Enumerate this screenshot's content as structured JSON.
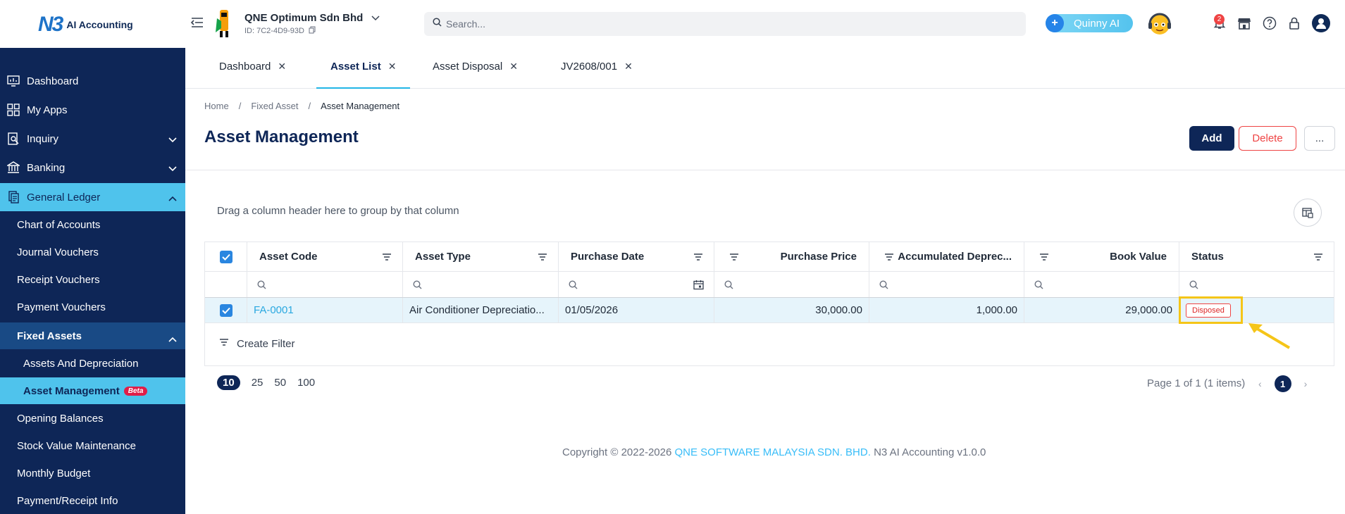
{
  "topbar": {
    "logo_mark": "N3",
    "logo_text": "AI Accounting",
    "company_name": "QNE Optimum Sdn Bhd",
    "company_id": "ID: 7C2-4D9-93D",
    "search_placeholder": "Search...",
    "assistant_label": "Quinny AI",
    "notification_count": "2"
  },
  "sidebar": {
    "items": [
      {
        "label": "Dashboard",
        "icon": "dashboard-icon"
      },
      {
        "label": "My Apps",
        "icon": "apps-icon"
      },
      {
        "label": "Inquiry",
        "icon": "inquiry-icon"
      },
      {
        "label": "Banking",
        "icon": "bank-icon"
      },
      {
        "label": "General Ledger",
        "icon": "ledger-icon"
      }
    ],
    "sub": {
      "chart_of_accounts": "Chart of Accounts",
      "journal_vouchers": "Journal Vouchers",
      "receipt_vouchers": "Receipt Vouchers",
      "payment_vouchers": "Payment Vouchers",
      "fixed_assets": "Fixed Assets",
      "assets_and_depreciation": "Assets And Depreciation",
      "asset_management": "Asset Management",
      "beta": "Beta",
      "opening_balances": "Opening Balances",
      "stock_value_maintenance": "Stock Value Maintenance",
      "monthly_budget": "Monthly Budget",
      "payment_receipt_info": "Payment/Receipt Info"
    }
  },
  "tabs": [
    {
      "label": "Dashboard"
    },
    {
      "label": "Asset List"
    },
    {
      "label": "Asset Disposal"
    },
    {
      "label": "JV2608/001"
    }
  ],
  "breadcrumb": [
    "Home",
    "Fixed Asset",
    "Asset Management"
  ],
  "breadcrumb_sep": "/",
  "page": {
    "title": "Asset Management",
    "add_label": "Add",
    "delete_label": "Delete",
    "more_label": "..."
  },
  "grid": {
    "group_hint": "Drag a column header here to group by that column",
    "columns": [
      "Asset Code",
      "Asset Type",
      "Purchase Date",
      "Purchase Price",
      "Accumulated Deprec...",
      "Book Value",
      "Status"
    ],
    "rows": [
      {
        "asset_code": "FA-0001",
        "asset_type": "Air Conditioner Depreciatio...",
        "purchase_date": "01/05/2026",
        "purchase_price": "30,000.00",
        "accumulated_depreciation": "1,000.00",
        "book_value": "29,000.00",
        "status": "Disposed"
      }
    ],
    "create_filter": "Create Filter"
  },
  "pager": {
    "sizes": [
      "10",
      "25",
      "50",
      "100"
    ],
    "selected_size": "10",
    "info": "Page 1 of 1 (1 items)",
    "current_page": "1",
    "prev": "‹",
    "next": "›"
  },
  "footer": {
    "prefix": "Copyright © 2022-2026",
    "company": "QNE SOFTWARE MALAYSIA SDN. BHD.",
    "suffix": "N3 AI Accounting v1.0.0"
  },
  "colors": {
    "sidebar_bg": "#0e2657",
    "accent": "#4fc3ec",
    "danger": "#ef4444",
    "highlight": "#f5c518"
  }
}
